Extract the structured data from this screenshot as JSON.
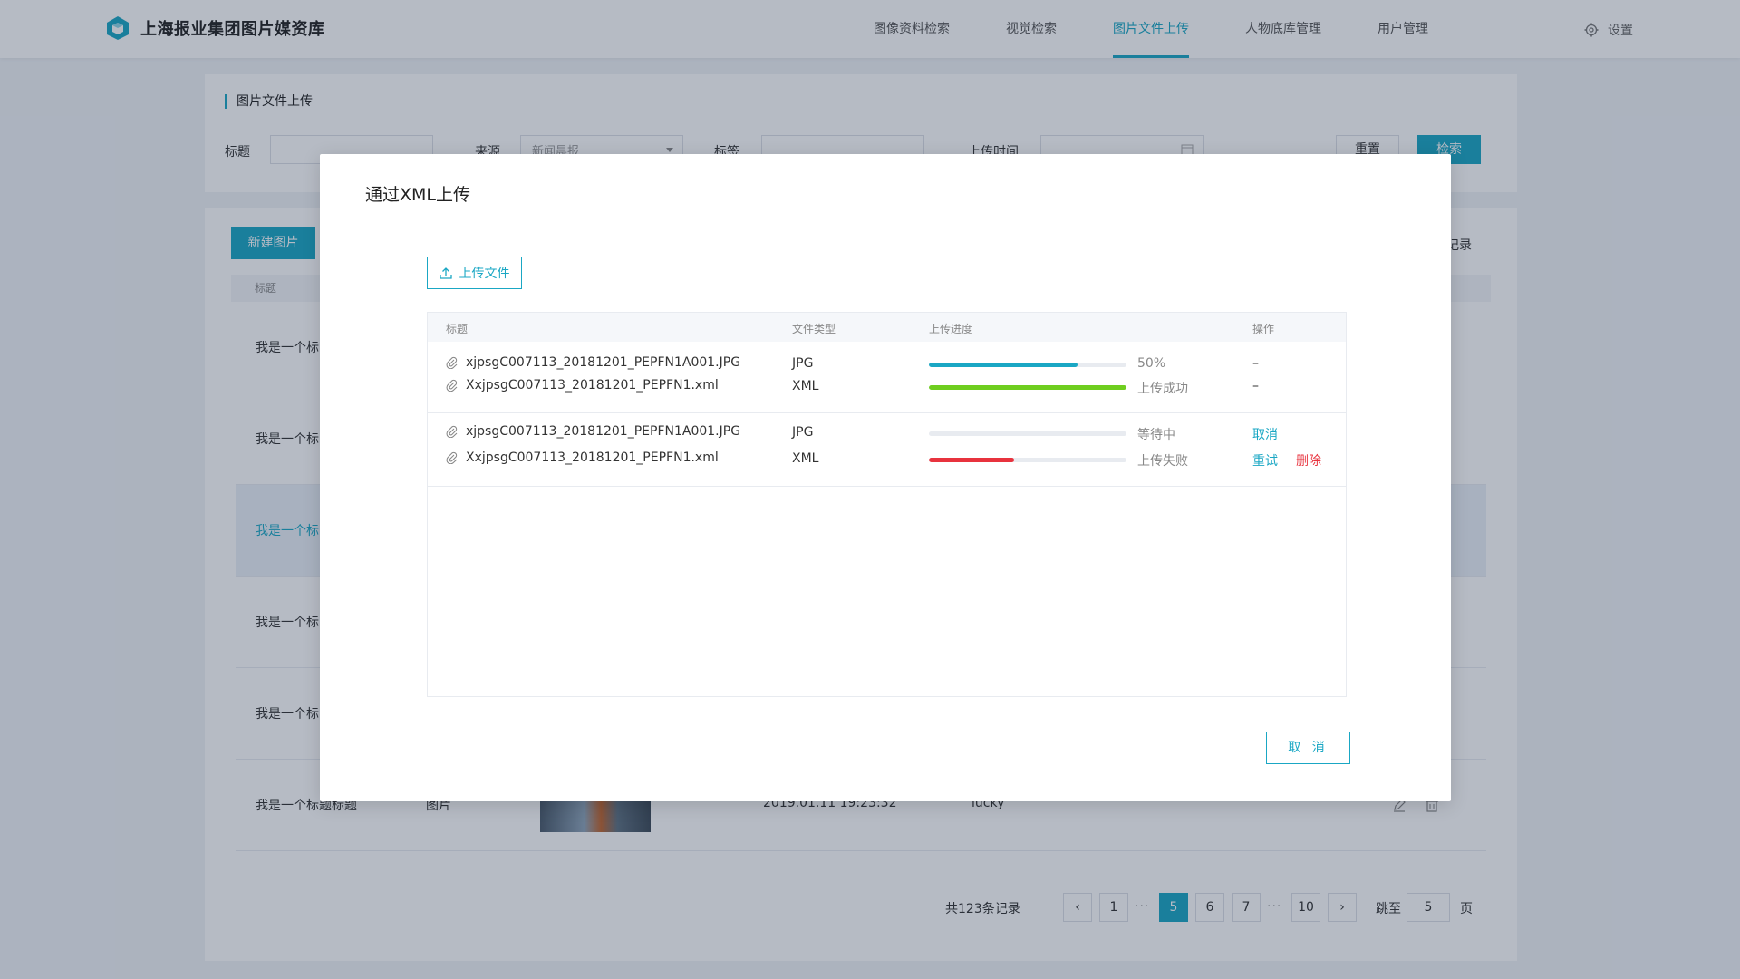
{
  "app": {
    "title": "上海报业集团图片媒资库",
    "nav": [
      "图像资料检索",
      "视觉检索",
      "图片文件上传",
      "人物底库管理",
      "用户管理"
    ],
    "active_nav_index": 2,
    "settings_label": "设置"
  },
  "filter": {
    "section_title": "图片文件上传",
    "title_label": "标题",
    "source_label": "来源",
    "source_value": "新闻晨报",
    "tag_label": "标签",
    "time_label": "上传时间",
    "reset_label": "重置",
    "search_label": "检索"
  },
  "list": {
    "new_button": "新建图片",
    "record_note": "记录",
    "header_title": "标题",
    "rows": [
      {
        "title": "我是一个标",
        "highlighted": false
      },
      {
        "title": "我是一个标",
        "highlighted": false
      },
      {
        "title": "我是一个标",
        "highlighted": true
      },
      {
        "title": "我是一个标",
        "highlighted": false
      },
      {
        "title": "我是一个标",
        "highlighted": false
      },
      {
        "title": "我是一个标题标题",
        "type": "图片",
        "date": "2019.01.11 19:23:32",
        "user": "lucky",
        "highlighted": false
      }
    ]
  },
  "pagination": {
    "total_text": "共123条记录",
    "pages": [
      "1",
      "5",
      "6",
      "7",
      "10"
    ],
    "active_page": "5",
    "jump_label": "跳至",
    "jump_value": "5",
    "page_suffix": "页",
    "dots": "···"
  },
  "modal": {
    "title": "通过XML上传",
    "upload_button": "上传文件",
    "table_headers": {
      "title": "标题",
      "type": "文件类型",
      "progress": "上传进度",
      "ops": "操作"
    },
    "groups": [
      [
        {
          "file": "xjpsgC007113_20181201_PEPFN1A001.JPG",
          "type": "JPG",
          "progress": 0.75,
          "bar_color": "#1aa7c4",
          "status": "50%",
          "op": "–"
        },
        {
          "file": "XxjpsgC007113_20181201_PEPFN1.xml",
          "type": "XML",
          "progress": 1.0,
          "bar_color": "#6fce1f",
          "status": "上传成功",
          "op": "–"
        }
      ],
      [
        {
          "file": "xjpsgC007113_20181201_PEPFN1A001.JPG",
          "type": "JPG",
          "progress": 0.0,
          "bar_color": "#1aa7c4",
          "status": "等待中",
          "op": "取消",
          "op_color": "blue"
        },
        {
          "file": "XxjpsgC007113_20181201_PEPFN1.xml",
          "type": "XML",
          "progress": 0.43,
          "bar_color": "#e8333e",
          "status": "上传失败",
          "op": "重试",
          "op_color": "blue",
          "op2": "删除",
          "op2_color": "red"
        }
      ]
    ],
    "cancel_button": "取 消"
  }
}
